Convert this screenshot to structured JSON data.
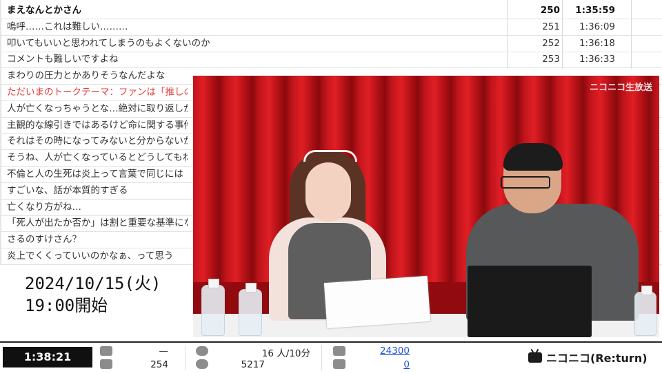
{
  "comments": [
    {
      "text": "まえなんとかさん",
      "num": "250",
      "time": "1:35:59",
      "style": "bold"
    },
    {
      "text": "嗚呼……これは難しい………",
      "num": "251",
      "time": "1:36:09",
      "style": ""
    },
    {
      "text": "叩いてもいいと思われてしまうのもよくないのか",
      "num": "252",
      "time": "1:36:18",
      "style": ""
    },
    {
      "text": "コメントも難しいですよね",
      "num": "253",
      "time": "1:36:33",
      "style": ""
    },
    {
      "text": "まわりの圧力とかありそうなんだよな",
      "style": "",
      "num": "",
      "time": ""
    },
    {
      "text": "ただいまのトークテーマ：ファンは「推しの炎上",
      "style": "red",
      "num": "",
      "time": ""
    },
    {
      "text": "人が亡くなっちゃうとな…絶対に取り返しがつ",
      "style": "",
      "num": "",
      "time": ""
    },
    {
      "text": "主観的な線引きではあるけど命に関する事件",
      "style": "",
      "num": "",
      "time": ""
    },
    {
      "text": "それはその時になってみないと分からないかも",
      "style": "",
      "num": "",
      "time": ""
    },
    {
      "text": "そうね、人が亡くなっているとどうしてもね……",
      "style": "",
      "num": "",
      "time": ""
    },
    {
      "text": "不倫と人の生死は炎上って言葉で同じには",
      "style": "",
      "num": "",
      "time": ""
    },
    {
      "text": "すごいな、話が本質的すぎる",
      "style": "",
      "num": "",
      "time": ""
    },
    {
      "text": "亡くなり方がね…",
      "style": "",
      "num": "",
      "time": ""
    },
    {
      "text": "「死人が出たか否か」は割と重要な基準にな",
      "style": "",
      "num": "",
      "time": ""
    },
    {
      "text": "さるのすけさん？",
      "style": "",
      "num": "",
      "time": ""
    },
    {
      "text": "炎上でくくっていいのかなぁ、って思う",
      "style": "",
      "num": "",
      "time": ""
    }
  ],
  "video": {
    "watermark": "ニコニコ生放送"
  },
  "schedule": {
    "date": "2024/10/15(火)",
    "start": "19:00開始"
  },
  "status": {
    "elapsed": "1:38:21",
    "comment_top": "—",
    "comment_count": "254",
    "viewers_rate": "16 人/10分",
    "viewers_total": "5217",
    "ad_points": "24300",
    "gift_points": "0"
  },
  "brand": {
    "logo_text": "ニコニコ(Re:turn)"
  },
  "colors": {
    "accent_red": "#e23c3c",
    "link_blue": "#1a4fd6"
  }
}
